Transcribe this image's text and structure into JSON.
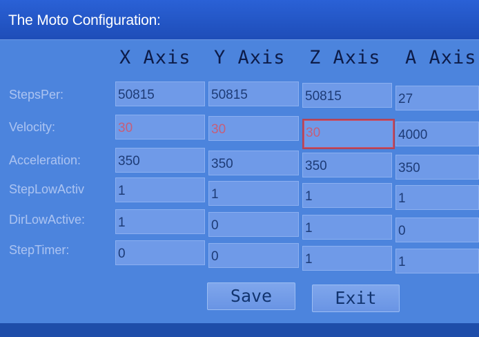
{
  "window": {
    "title": "The Moto Configuration:"
  },
  "axes": [
    {
      "label": "X Axis"
    },
    {
      "label": "Y Axis"
    },
    {
      "label": "Z Axis"
    },
    {
      "label": "A Axis"
    }
  ],
  "rows": [
    {
      "label": "StepsPer:",
      "values": [
        "50815",
        "50815",
        "50815",
        "27"
      ]
    },
    {
      "label": "Velocity:",
      "values": [
        "30",
        "30",
        "30",
        "4000"
      ]
    },
    {
      "label": "Acceleration:",
      "values": [
        "350",
        "350",
        "350",
        "350"
      ]
    },
    {
      "label": "StepLowActiv",
      "values": [
        "1",
        "1",
        "1",
        "1"
      ]
    },
    {
      "label": "DirLowActive:",
      "values": [
        "1",
        "0",
        "1",
        "0"
      ]
    },
    {
      "label": "StepTimer:",
      "values": [
        "0",
        "0",
        "1",
        "1"
      ]
    }
  ],
  "buttons": {
    "save": "Save",
    "exit": "Exit"
  },
  "colors": {
    "background": "#4c84dd",
    "title_bar": "#2a61d6",
    "field": "#6f9ae8",
    "field_text": "#1d3b76",
    "velocity_text": "#c55e7a",
    "active_border": "#b34458"
  },
  "active_field": {
    "row": "Velocity:",
    "axis": "Z Axis"
  }
}
